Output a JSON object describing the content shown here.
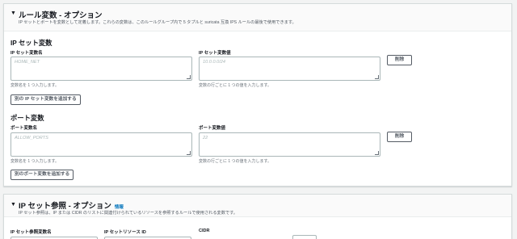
{
  "rule_variables": {
    "title": "ルール変数 - オプション",
    "description": "IP セットとポートを変数として定義します。これらの変数は、このルールグループ内で 5 タプルと suricata 互換 IPS ルールの最後で使用できます。",
    "ip_sets": {
      "section_title": "IP セット変数",
      "name_label": "IP セット変数名",
      "name_placeholder": "HOME_NET",
      "value_label": "IP セット変数値",
      "value_placeholder": "10.0.0.0/24",
      "remove_label": "削除",
      "name_hint": "変数名を 1 つ入力します。",
      "value_hint": "変数の行ごとに 1 つの値を入力します。",
      "add_button": "別の IP セット変数を追加する"
    },
    "ports": {
      "section_title": "ポート変数",
      "name_label": "ポート変数名",
      "name_placeholder": "ALLOW_PORTS",
      "value_label": "ポート変数値",
      "value_placeholder": "22",
      "remove_label": "削除",
      "name_hint": "変数名を 1 つ入力します。",
      "value_hint": "変数の行ごとに 1 つの値を入力します。",
      "add_button": "別のポート変数を追加する"
    }
  },
  "ip_set_references": {
    "title": "IP セット参照 - オプション",
    "info_link": "情報",
    "description": "IP セット参照は、IP または CIDR のリストに関連付けられているリソースを参照するルールで使用される変数です。",
    "columns": {
      "name": "IP セット参照変数名",
      "resource_id": "IP セットリソース ID",
      "cidr": "CIDR"
    }
  }
}
